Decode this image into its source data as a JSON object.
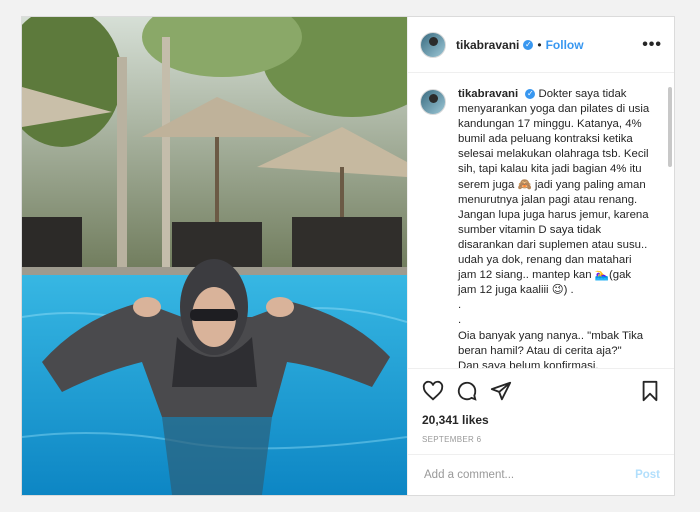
{
  "post": {
    "username": "tikabravani",
    "follow_label": "Follow",
    "more_glyph": "•••",
    "caption": "Dokter saya tidak\nmenyarankan yoga dan pilates di usia\nkandungan 17 minggu. Katanya, 4%\nbumil ada peluang kontraksi ketika\nselesai melakukan olahraga tsb. Kecil\nsih, tapi kalau kita jadi bagian 4% itu\nserem juga 🙈 jadi yang paling aman\nmenurutnya jalan pagi atau renang.\nJangan lupa juga harus jemur, karena\nsumber vitamin D saya tidak\ndisarankan dari suplemen atau susu..\nudah ya dok, renang dan matahari\njam 12 siang.. mantep kan 🏊‍♀️(gak\njam 12 juga kaaliii 😉) .\n.\n.\nOia banyak yang nanya.. \"mbak Tika\nberan hamil? Atau di cerita aja?\"\nDan saya belum konfirmasi.\nJawabannya iya, Alhamdulillah",
    "likes": "20,341 likes",
    "date": "SEPTEMBER 6",
    "comment_placeholder": "Add a comment...",
    "post_label": "Post"
  },
  "icons": {
    "like": "heart-icon",
    "comment": "comment-icon",
    "share": "share-icon",
    "save": "bookmark-icon",
    "verified": "verified-badge-icon"
  },
  "colors": {
    "link": "#3897f0",
    "post_disabled": "#b2dffc",
    "pool": "#1a9fd0"
  }
}
